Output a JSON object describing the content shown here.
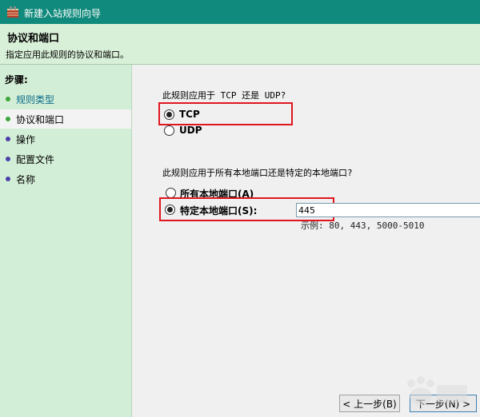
{
  "window": {
    "title": "新建入站规则向导"
  },
  "header": {
    "title": "协议和端口",
    "subtitle": "指定应用此规则的协议和端口。"
  },
  "sidebar": {
    "steps_label": "步骤:",
    "items": [
      {
        "label": "规则类型"
      },
      {
        "label": "协议和端口"
      },
      {
        "label": "操作"
      },
      {
        "label": "配置文件"
      },
      {
        "label": "名称"
      }
    ]
  },
  "main": {
    "protocol_question": "此规则应用于 TCP 还是 UDP?",
    "tcp_label": "TCP",
    "udp_label": "UDP",
    "protocol_selected": "TCP",
    "port_question": "此规则应用于所有本地端口还是特定的本地端口?",
    "all_ports_label": "所有本地端口(A)",
    "specific_ports_label": "特定本地端口(S):",
    "ports_selected": "specific",
    "port_value": "445",
    "example": "示例: 80, 443, 5000-5010"
  },
  "buttons": {
    "back": "< 上一步(B)",
    "next": "下一步(N) >"
  },
  "colors": {
    "titlebar": "#108a7c",
    "header_bg": "#d9f0d8",
    "sidebar_bg": "#d3eed7",
    "highlight_box": "#e0161f"
  }
}
